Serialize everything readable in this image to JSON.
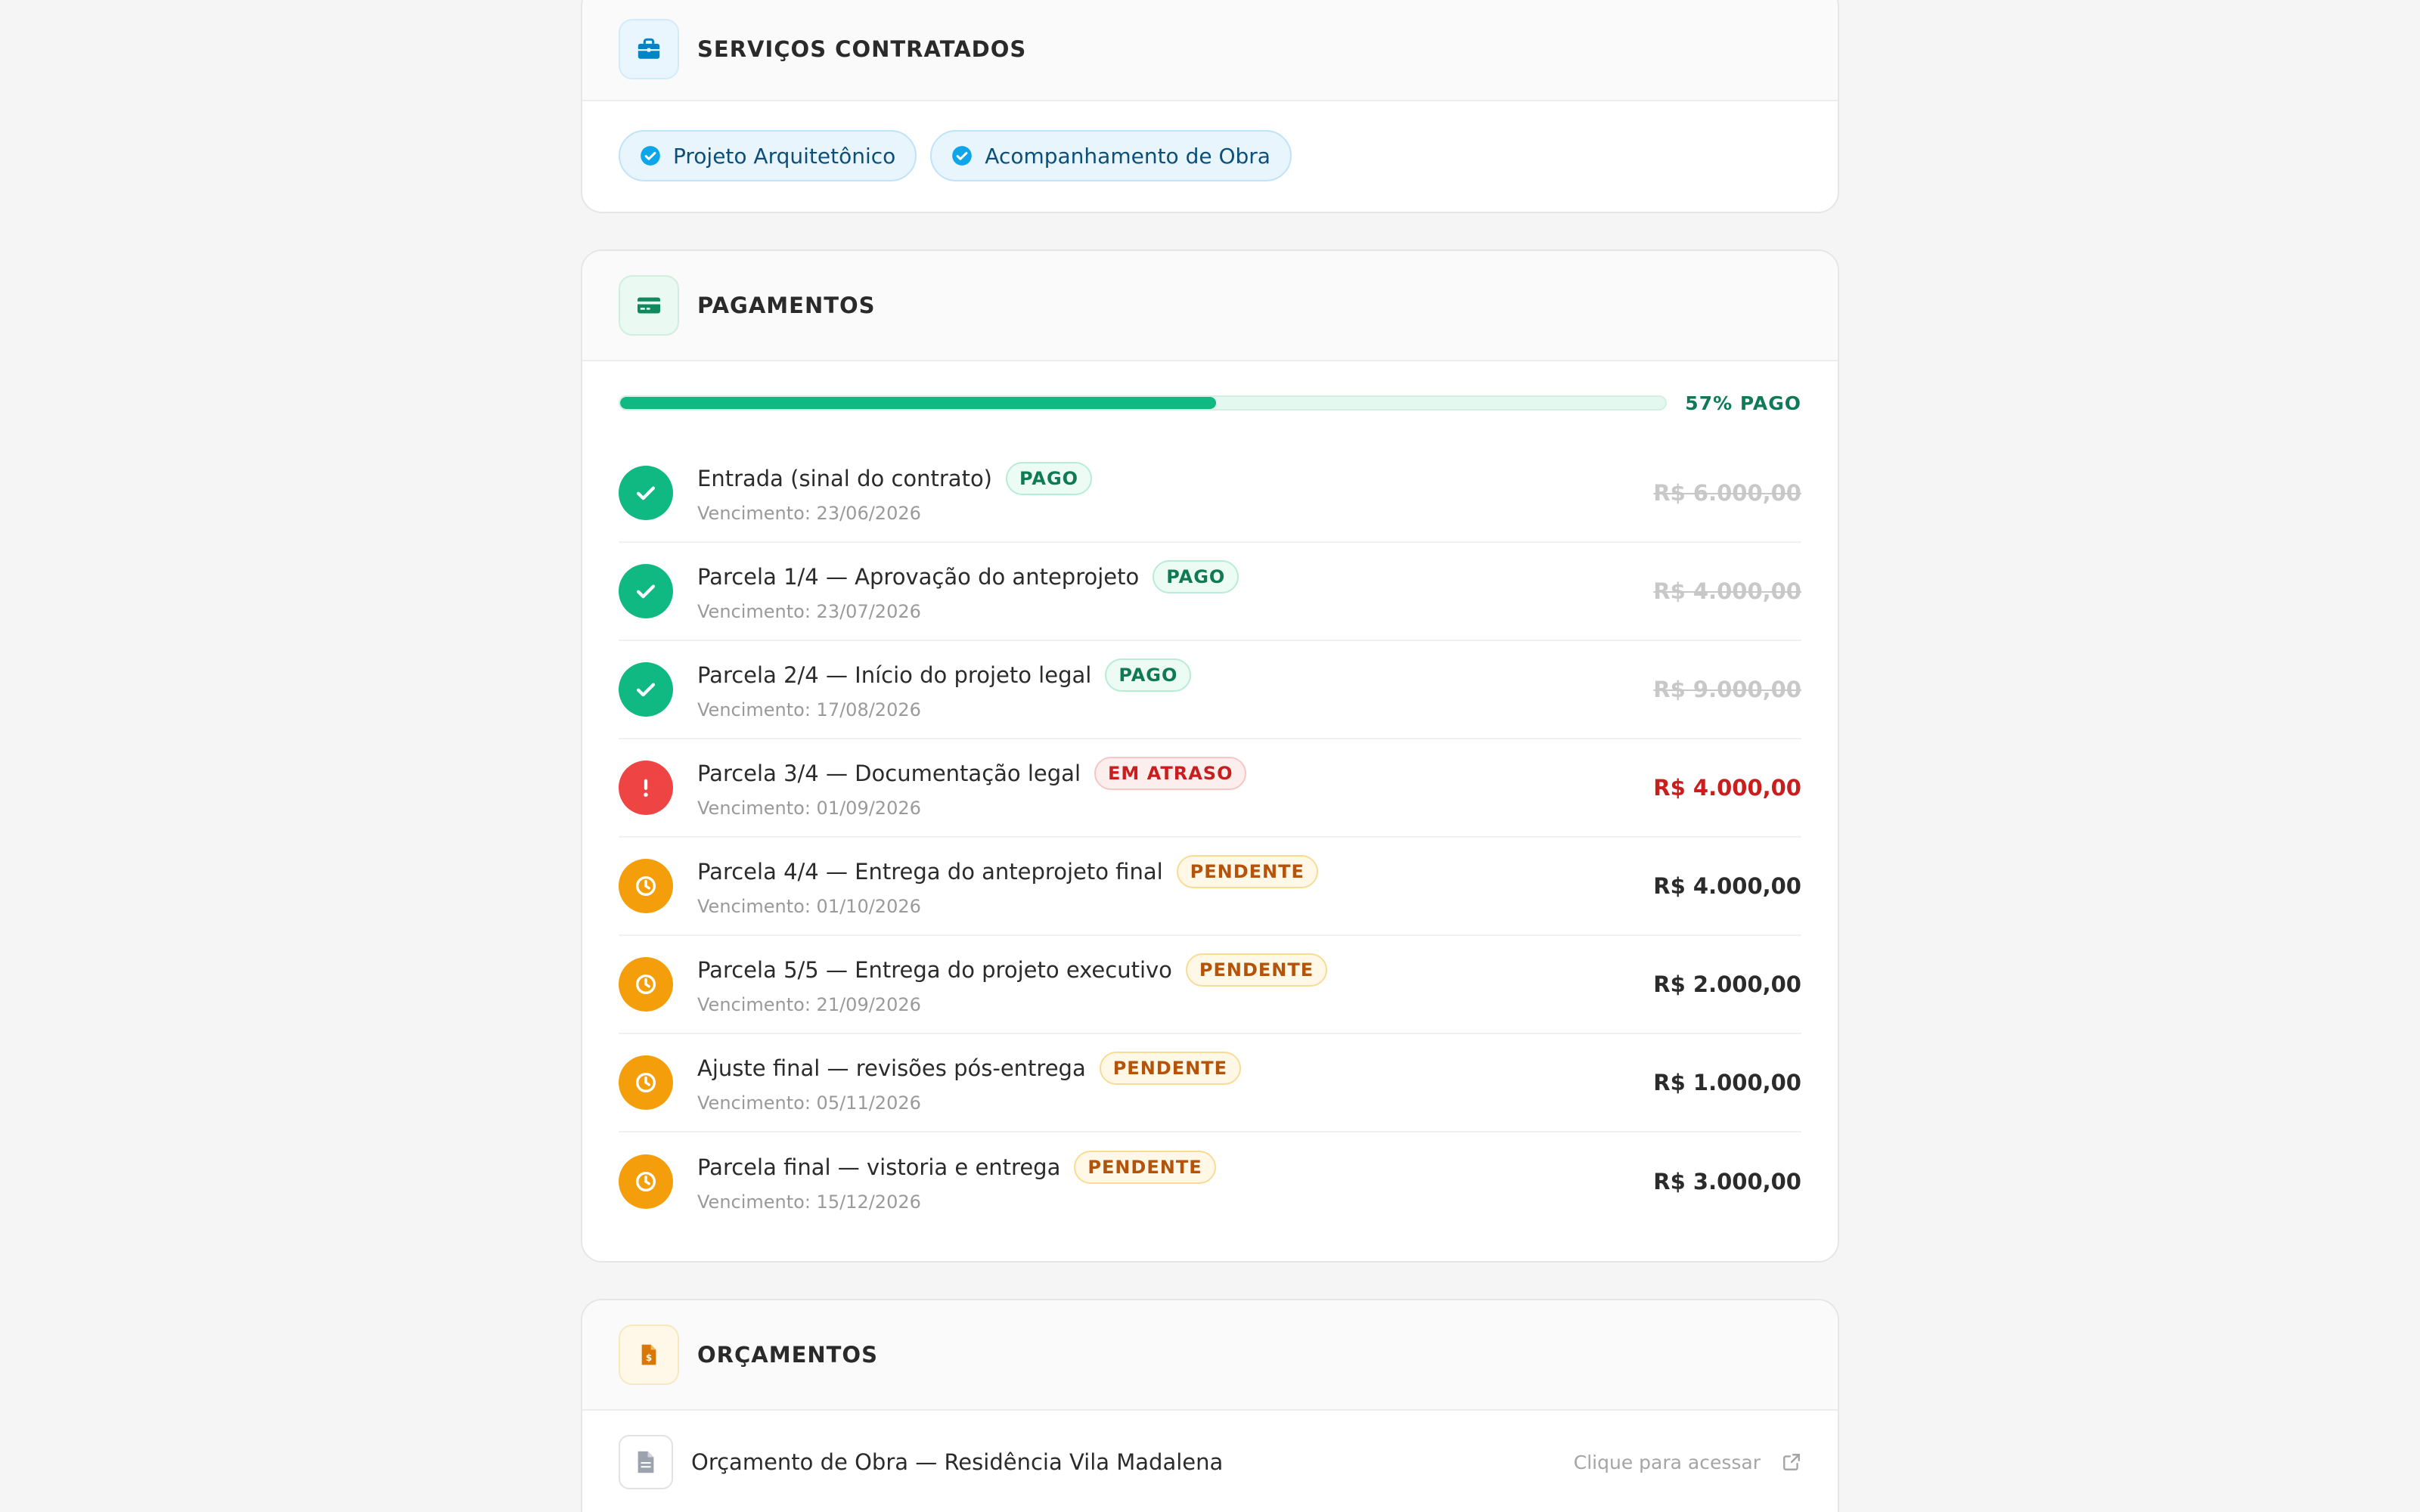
{
  "services": {
    "title": "SERVIÇOS CONTRATADOS",
    "icon": "briefcase-icon",
    "items": [
      {
        "label": "Projeto Arquitetônico"
      },
      {
        "label": "Acompanhamento de Obra"
      }
    ]
  },
  "payments": {
    "title": "PAGAMENTOS",
    "icon": "credit-card-icon",
    "progress_percent": 57,
    "progress_label": "57% PAGO",
    "items": [
      {
        "title": "Entrada (sinal do contrato)",
        "status": "paid",
        "badge": "PAGO",
        "due": "Vencimento: 23/06/2026",
        "amount": "R$ 6.000,00"
      },
      {
        "title": "Parcela 1/4 — Aprovação do anteprojeto",
        "status": "paid",
        "badge": "PAGO",
        "due": "Vencimento: 23/07/2026",
        "amount": "R$ 4.000,00"
      },
      {
        "title": "Parcela 2/4 — Início do projeto legal",
        "status": "paid",
        "badge": "PAGO",
        "due": "Vencimento: 17/08/2026",
        "amount": "R$ 9.000,00"
      },
      {
        "title": "Parcela 3/4 — Documentação legal",
        "status": "late",
        "badge": "EM ATRASO",
        "due": "Vencimento: 01/09/2026",
        "amount": "R$ 4.000,00"
      },
      {
        "title": "Parcela 4/4 — Entrega do anteprojeto final",
        "status": "pending",
        "badge": "PENDENTE",
        "due": "Vencimento: 01/10/2026",
        "amount": "R$ 4.000,00"
      },
      {
        "title": "Parcela 5/5 — Entrega do projeto executivo",
        "status": "pending",
        "badge": "PENDENTE",
        "due": "Vencimento: 21/09/2026",
        "amount": "R$ 2.000,00"
      },
      {
        "title": "Ajuste final — revisões pós-entrega",
        "status": "pending",
        "badge": "PENDENTE",
        "due": "Vencimento: 05/11/2026",
        "amount": "R$ 1.000,00"
      },
      {
        "title": "Parcela final — vistoria e entrega",
        "status": "pending",
        "badge": "PENDENTE",
        "due": "Vencimento: 15/12/2026",
        "amount": "R$ 3.000,00"
      }
    ]
  },
  "budgets": {
    "title": "ORÇAMENTOS",
    "icon": "invoice-icon",
    "items": [
      {
        "title": "Orçamento de Obra — Residência Vila Madalena",
        "link_label": "Clique para acessar"
      }
    ]
  },
  "colors": {
    "paid": "#10b981",
    "late": "#ef4444",
    "pending": "#f59e0b",
    "accent_blue": "#0ea5e9"
  }
}
